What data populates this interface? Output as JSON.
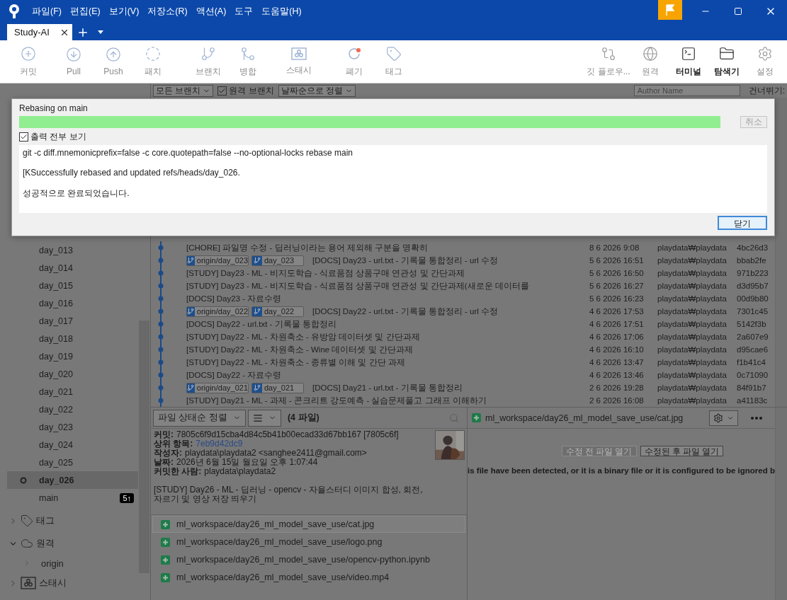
{
  "menu": [
    "파일(F)",
    "편집(E)",
    "보기(V)",
    "저장소(R)",
    "액션(A)",
    "도구",
    "도움말(H)"
  ],
  "tabs": [
    {
      "label": "Study-AI",
      "selected": true
    }
  ],
  "toolbar": {
    "groups": [
      [
        {
          "label": "커밋",
          "disabled": true
        },
        {
          "label": "Pull",
          "disabled": true
        },
        {
          "label": "Push",
          "disabled": true
        },
        {
          "label": "패치",
          "disabled": true
        }
      ],
      [
        {
          "label": "브랜치",
          "disabled": true
        },
        {
          "label": "병합",
          "disabled": true
        }
      ],
      [
        {
          "label": "스태시",
          "disabled": true
        }
      ],
      [
        {
          "label": "폐기",
          "disabled": true
        },
        {
          "label": "태그",
          "disabled": true
        }
      ]
    ],
    "right": [
      {
        "label": "깃 플로우...",
        "disabled": true
      },
      {
        "label": "원격",
        "disabled": true
      },
      {
        "label": "터미널",
        "disabled": false
      },
      {
        "label": "탐색기",
        "disabled": false
      },
      {
        "label": "설정",
        "disabled": true
      }
    ]
  },
  "filter_bar": {
    "branch_filter": "모든 브랜치",
    "remote_branches": {
      "label": "원격 브랜치",
      "checked": true
    },
    "sort": "날짜순으로 정렬",
    "author_search": {
      "placeholder": "Author Name"
    },
    "skip_label": "건너뛰기:"
  },
  "sidebar": {
    "branches": [
      {
        "label": "day_013",
        "selected": false
      },
      {
        "label": "day_014",
        "selected": false
      },
      {
        "label": "day_015",
        "selected": false
      },
      {
        "label": "day_016",
        "selected": false
      },
      {
        "label": "day_017",
        "selected": false
      },
      {
        "label": "day_018",
        "selected": false
      },
      {
        "label": "day_019",
        "selected": false
      },
      {
        "label": "day_020",
        "selected": false
      },
      {
        "label": "day_021",
        "selected": false
      },
      {
        "label": "day_022",
        "selected": false
      },
      {
        "label": "day_023",
        "selected": false
      },
      {
        "label": "day_024",
        "selected": false
      },
      {
        "label": "day_025",
        "selected": false
      },
      {
        "label": "day_026",
        "selected": true
      },
      {
        "label": "main",
        "selected": false,
        "badge": "5↑"
      }
    ],
    "sections": [
      {
        "label": "태그",
        "expanded": false
      },
      {
        "label": "원격",
        "expanded": true,
        "children": [
          {
            "label": "origin",
            "expanded": false
          }
        ]
      },
      {
        "label": "스태시",
        "expanded": false
      }
    ]
  },
  "commits": [
    {
      "message": "[CHORE] 파일명 수정 - 딥러닝이라는 용어 제외해 구분을 명확히",
      "date": "8 6 2026 9:08",
      "author": "playdata₩playdata",
      "hash": "4bc26d3"
    },
    {
      "refs": [
        "origin/day_023",
        "day_023"
      ],
      "message": "[DOCS] Day23 - url.txt - 기록물 통합정리 - url 수정",
      "date": "5 6 2026 16:51",
      "author": "playdata₩playdata",
      "hash": "bbab2fe"
    },
    {
      "message": "[STUDY] Day23 - ML - 비지도학습 - 식료품점 상품구매 연관성 및 간단과제",
      "date": "5 6 2026 16:50",
      "author": "playdata₩playdata",
      "hash": "971b223"
    },
    {
      "message": "[STUDY] Day23 - ML - 비지도학습 -  식료품점 상품구매 연관성 및 간단과제(새로운 데이터를",
      "date": "5 6 2026 16:27",
      "author": "playdata₩playdata",
      "hash": "d3d95b7"
    },
    {
      "message": "[DOCS] Day23 - 자료수령",
      "date": "5 6 2026 16:23",
      "author": "playdata₩playdata",
      "hash": "00d9b80"
    },
    {
      "refs": [
        "origin/day_022",
        "day_022"
      ],
      "message": "[DOCS] Day22 - url.txt - 기록물 통합정리 - url 수정",
      "date": "4 6 2026 17:53",
      "author": "playdata₩playdata",
      "hash": "7301c45"
    },
    {
      "message": "[DOCS] Day22 - url.txt - 기록물 통합정리",
      "date": "4 6 2026 17:51",
      "author": "playdata₩playdata",
      "hash": "5142f3b"
    },
    {
      "message": "[STUDY] Day22 - ML - 차원축소 - 유방암 데이터셋 및 간단과제",
      "date": "4 6 2026 17:06",
      "author": "playdata₩playdata",
      "hash": "2a607e9"
    },
    {
      "message": "[STUDY] Day22 - ML - 차원축소 - Wine 데이터셋 및 간단과제",
      "date": "4 6 2026 16:10",
      "author": "playdata₩playdata",
      "hash": "d95cae6"
    },
    {
      "message": "[STUDY] Day22 - ML - 차원축소 - 종류별 이해 및 간단 과제",
      "date": "4 6 2026 13:47",
      "author": "playdata₩playdata",
      "hash": "f1b41c4"
    },
    {
      "message": "[DOCS] Day22 - 자료수령",
      "date": "4 6 2026 13:46",
      "author": "playdata₩playdata",
      "hash": "0c71090"
    },
    {
      "refs": [
        "origin/day_021",
        "day_021"
      ],
      "message": "[DOCS] Day21 - url.txt - 기록물 통합정리",
      "date": "2 6 2026 19:28",
      "author": "playdata₩playdata",
      "hash": "84f91b7"
    },
    {
      "message": "[STUDY] Day21 - ML - 과제 - 콘크리트 강도예측 - 실습문제풀고 그래프 이해하기",
      "date": "2 6 2026 16:08",
      "author": "playdata₩playdata",
      "hash": "a41183c"
    }
  ],
  "file_pane": {
    "sort": "파일 상태순 정렬",
    "count": "(4 파일)",
    "details": [
      {
        "kind": "text",
        "label": "커밋:",
        "value": "7805c6f9d15cba4d84c5b41b00ecad33d67bb167 [7805c6f]"
      },
      {
        "kind": "link",
        "label": "상위 항목:",
        "value": "7eb9d42dc9"
      },
      {
        "kind": "text",
        "label": "작성자:",
        "value": "playdata\\playdata2 <sanghee2411@gmail.com>"
      },
      {
        "kind": "text",
        "label": "날짜:",
        "value": "2026년 6월 15일 월요일 오후 1:07:44"
      },
      {
        "kind": "text",
        "label": "커밋한 사람:",
        "value": "playdata\\playdata2"
      }
    ],
    "message": "[STUDY] Day26 - ML - 딥러닝 - opencv - 자율스터디 이미지 합성, 회전, 자르기 및 영상 저장 띄우기",
    "files": [
      {
        "path": "ml_workspace/day26_ml_model_save_use/cat.jpg",
        "selected": true
      },
      {
        "path": "ml_workspace/day26_ml_model_save_use/logo.png",
        "selected": false
      },
      {
        "path": "ml_workspace/day26_ml_model_save_use/opencv-python.ipynb",
        "selected": false
      },
      {
        "path": "ml_workspace/day26_ml_model_save_use/video.mp4",
        "selected": false
      }
    ]
  },
  "diff_pane": {
    "path": "ml_workspace/day26_ml_model_save_use/cat.jpg",
    "buttons": [
      {
        "label": "수정 전 파일 열기",
        "disabled": true
      },
      {
        "label": "수정된 후 파일 열기",
        "disabled": false
      }
    ],
    "notice": "is file have been detected, or it is a binary file or it is configured to be ignored b"
  },
  "dialog": {
    "title": "Rebasing on main",
    "progress": {
      "level": 1
    },
    "cancel_button": {
      "label": "취소",
      "disabled": true
    },
    "show_all_output": {
      "label": "출력 전부 보기",
      "checked": true
    },
    "output": [
      "git -c diff.mnemonicprefix=false -c core.quotepath=false --no-optional-locks rebase main",
      "[KSuccessfully rebased and updated refs/heads/day_026.",
      "성공적으로 완료되었습니다."
    ],
    "close_button": "닫기"
  }
}
